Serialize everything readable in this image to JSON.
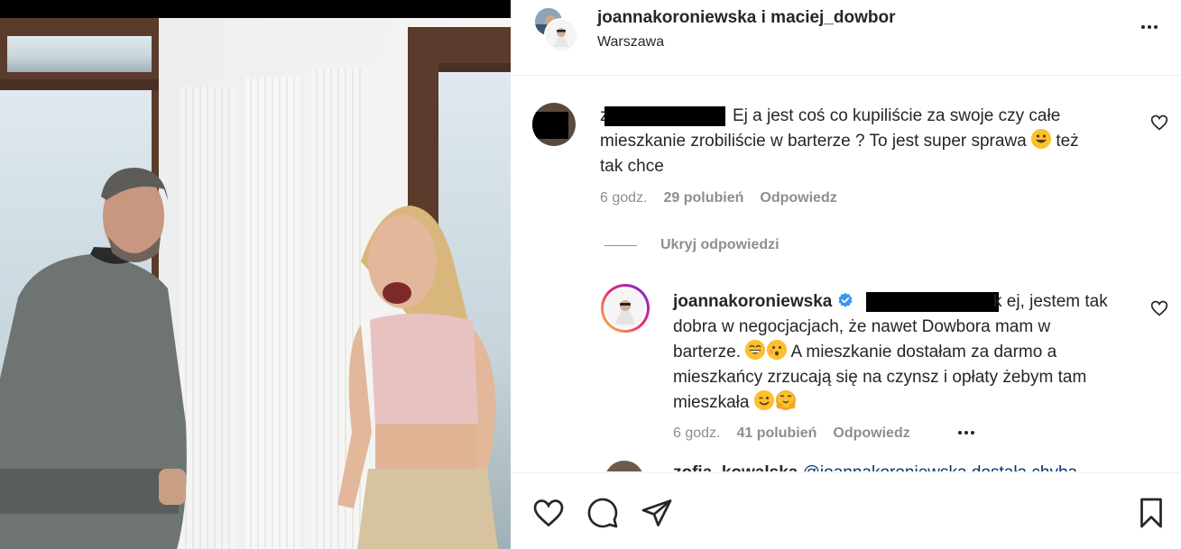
{
  "post": {
    "authors": "joannakoroniewska i maciej_dowbor",
    "location": "Warszawa",
    "more_icon": "more-horizontal-icon"
  },
  "comments": [
    {
      "username_prefix": "z",
      "text": "Ej a jest coś co kupiliście za swoje czy całe mieszkanie zrobiliście w barterze ? To jest super sprawa 😀 też tak chce",
      "line1": "Ej a jest coś co kupiliście za swoje czy całe",
      "line2": "mieszkanie zrobiliście w barterze ? To jest super sprawa",
      "line2_tail": "też",
      "line3": "tak chce",
      "time": "6 godz.",
      "likes": "29 polubień",
      "reply": "Odpowiedz"
    }
  ],
  "hide_replies": "Ukryj odpowiedzi",
  "reply": {
    "username": "joannakoroniewska",
    "mention_tail": "k ej, jestem tak",
    "line2": "dobra w negocjacjach, że nawet Dowbora mam w",
    "line3_a": "barterze.",
    "line3_b": "A mieszkanie dostałam za darmo a",
    "line4": "mieszkańcy zrzucają się na czynsz i opłaty żebym tam",
    "line5": "mieszkała",
    "time": "6 godz.",
    "likes": "41 polubień",
    "reply": "Odpowiedz"
  },
  "partial_comment": {
    "username": "zofia_kowalska",
    "mention": "@joannakoroniewska dostała chyba"
  },
  "actions": {
    "like_icon": "heart-icon",
    "comment_icon": "comment-icon",
    "share_icon": "send-icon",
    "save_icon": "bookmark-icon"
  },
  "colors": {
    "text": "#262626",
    "secondary": "#8e8e8e",
    "verified": "#3897f0",
    "story_ring_start": "#f9ce34",
    "story_ring_mid": "#ee2a7b",
    "story_ring_end": "#6228d7"
  }
}
